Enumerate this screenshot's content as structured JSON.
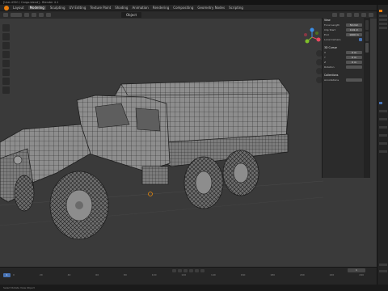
{
  "window": {
    "title": "[Ural-4320 / Cargo.blend] - Blender 4.1"
  },
  "menubar": {
    "tabs": [
      "Layout",
      "Modeling",
      "Sculpting",
      "UV Editing",
      "Texture Paint",
      "Shading",
      "Animation",
      "Rendering",
      "Compositing",
      "Geometry Nodes",
      "Scripting"
    ],
    "active_index": 1
  },
  "viewport": {
    "object_label": "Object",
    "shading": "wireframe-overlay"
  },
  "npanel": {
    "sections": [
      {
        "heading": "View",
        "rows": [
          [
            "Focal Length",
            "50 mm"
          ],
          [
            "Clip Start",
            "0.01 m"
          ],
          [
            "End",
            "1000 m"
          ],
          [
            "Local Camera",
            ""
          ]
        ]
      },
      {
        "heading": "3D Cursor",
        "rows": [
          [
            "X",
            "0 m"
          ],
          [
            "Y",
            "0 m"
          ],
          [
            "Z",
            "0 m"
          ],
          [
            "Rotation",
            ""
          ]
        ]
      },
      {
        "heading": "Collections",
        "rows": [
          [
            "Annotations",
            ""
          ]
        ]
      }
    ]
  },
  "timeline": {
    "frame_current": "1",
    "ticks": [
      "0",
      "20",
      "40",
      "60",
      "80",
      "100",
      "120",
      "140",
      "160",
      "180",
      "200",
      "220",
      "240"
    ]
  },
  "status": {
    "text": "Select   Rotate View   Object"
  },
  "colors": {
    "viewport_bg": "#3a3a3a",
    "mesh_fill": "#8d8d8d",
    "mesh_wire": "#1e1e1e",
    "accent": "#4772b3",
    "logo": "#e87d0d"
  }
}
